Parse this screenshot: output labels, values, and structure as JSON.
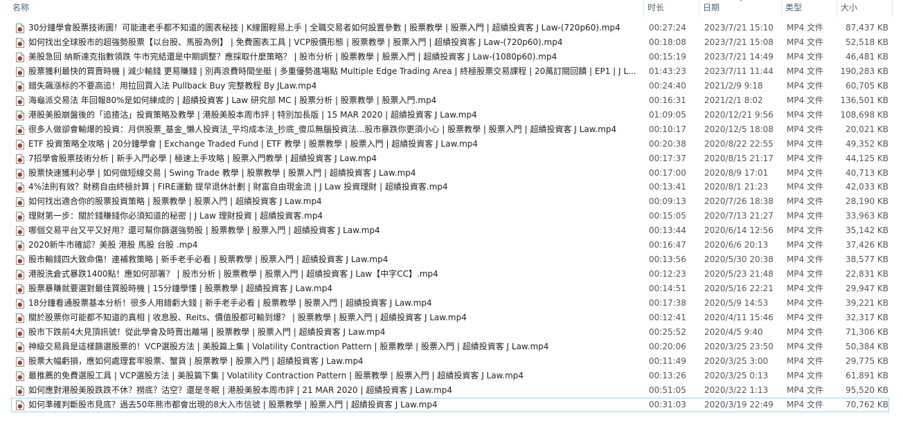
{
  "header": {
    "columns": {
      "name": "名称",
      "duration": "时长",
      "date": "日期",
      "type": "类型",
      "size": "大小"
    },
    "sorted_column": "date"
  },
  "file_icon": "video-file-icon",
  "files": [
    {
      "name": "30分鐘學會股票技術圖！可能連老手都不知道的圖表秘技 | K線圖輕易上手 | 全職交易者如何設置參數 | 股票教學 | 股票入門 | 超績投資客 J Law-(720p60).mp4",
      "duration": "00:27:24",
      "date": "2023/7/21 15:10",
      "type": "MP4 文件",
      "size": "87,437 KB"
    },
    {
      "name": "如何找出全球股市的超強勢股票【以台股、馬股為例】 | 免費圖表工具 | VCP股價形態 | 股票教學 | 股票入門 | 超績投資客 J Law-(720p60).mp4",
      "duration": "00:18:08",
      "date": "2023/7/21 15:08",
      "type": "MP4 文件",
      "size": "52,518 KB"
    },
    {
      "name": "美股急回 納斯達克指數領跌 牛市完結還是中期調整？應採取什麼策略？ | 股市分析 | 股票教學 | 股票入門 | 超績投資客 J Law-(1080p60).mp4",
      "duration": "00:15:19",
      "date": "2023/7/21 14:49",
      "type": "MP4 文件",
      "size": "46,481 KB"
    },
    {
      "name": "股票獲利最快的買賣時機 | 減少輸錢 更易賺錢 | 別再浪費時間坐艇 | 多重優勢進場點 Multiple Edge Trading Area | 終極股票交易課程 | 20萬訂閱回饋 | EP1 | J L...",
      "duration": "01:43:23",
      "date": "2023/7/11 11:44",
      "type": "MP4 文件",
      "size": "190,283 KB"
    },
    {
      "name": "錯失飆漲标的不要高追！用拉回買入法 Pullback Buy 完整教程 By JLaw.mp4",
      "duration": "00:24:40",
      "date": "2021/2/9 9:18",
      "type": "MP4 文件",
      "size": "60,705 KB"
    },
    {
      "name": "海龜派交易法 年回報80%是如何練成的 | 超績投資客 J Law 研究部 MC | 股票分析 | 股票教學 | 股票入門.mp4",
      "duration": "00:16:31",
      "date": "2021/2/1 8:02",
      "type": "MP4 文件",
      "size": "136,501 KB"
    },
    {
      "name": "港股美股崩盤後的「追揸沽」投資策略及教學 | 港股美股本周市評 | 特別加長版 | 15 MAR 2020 | 超績投資客 J Law.mp4",
      "duration": "01:09:05",
      "date": "2020/12/21 9:56",
      "type": "MP4 文件",
      "size": "108,698 KB"
    },
    {
      "name": "很多人做卻會輸爆的投資：月供股票_基金_懶人投資法_平均成本法_抄底_傻瓜無腦投資法...股市暴跌你更須小心 | 股票教學 | 股票入門 | 超績投資客 J Law.mp4",
      "duration": "00:10:17",
      "date": "2020/12/5 18:08",
      "type": "MP4 文件",
      "size": "20,021 KB"
    },
    {
      "name": "ETF 投資策略全攻略 | 20分鐘學會 | Exchange Traded Fund | ETF 教學 | 股票教學 | 股票入門 | 超績投資客 J Law.mp4",
      "duration": "00:20:38",
      "date": "2020/8/22 22:55",
      "type": "MP4 文件",
      "size": "49,352 KB"
    },
    {
      "name": "7招學會股票技術分析 | 新手入門必學 | 極速上手攻略 | 股票入門教學 | 超績投資客 J Law.mp4",
      "duration": "00:17:37",
      "date": "2020/8/15 21:17",
      "type": "MP4 文件",
      "size": "44,125 KB"
    },
    {
      "name": "股票快速獲利必學 | 如何做短線交易 | Swing Trade 教學 | 股票教學 | 股票入門 | 超績投資客 J Law.mp4",
      "duration": "00:17:00",
      "date": "2020/8/9 17:01",
      "type": "MP4 文件",
      "size": "40,713 KB"
    },
    {
      "name": "4%法則有效？財務自由終極計算 | FIRE運動 提早退休計劃 | 財富自由現金流 | J Law 投資理財 | 超績投資客.mp4",
      "duration": "00:13:41",
      "date": "2020/8/1 21:23",
      "type": "MP4 文件",
      "size": "42,033 KB"
    },
    {
      "name": "如何找出適合你的股票投資策略 | 股票教學 | 股票入門 | 超績投資客 J Law.mp4",
      "duration": "00:09:13",
      "date": "2020/7/26 18:38",
      "type": "MP4 文件",
      "size": "28,190 KB"
    },
    {
      "name": "理財第一步：關於錢賺錢你必須知道的秘密 | J Law 理財投資 | 超績投資客.mp4",
      "duration": "00:15:05",
      "date": "2020/7/13 21:27",
      "type": "MP4 文件",
      "size": "33,963 KB"
    },
    {
      "name": "哪個交易平台又平又好用？還可幫你篩選強勢股 | 股票教學 | 股票入門 | 超績投資客 J Law.mp4",
      "duration": "00:13:44",
      "date": "2020/6/14 12:56",
      "type": "MP4 文件",
      "size": "35,142 KB"
    },
    {
      "name": "2020新牛市確認？美股 港股 馬股 台股 .mp4",
      "duration": "00:16:47",
      "date": "2020/6/6 20:13",
      "type": "MP4 文件",
      "size": "37,426 KB"
    },
    {
      "name": "股市輸錢四大致命傷！連補救策略 | 新手老手必看 | 股票教學 | 股票入門 | 超績投資客 J Law.mp4",
      "duration": "00:13:56",
      "date": "2020/5/30 20:38",
      "type": "MP4 文件",
      "size": "38,577 KB"
    },
    {
      "name": "港股洗倉式暴跌1400點！應如何部署？ | 股市分析 | 股票教學 | 股票入門 | 超績投資客 J Law【中字CC】.mp4",
      "duration": "00:12:23",
      "date": "2020/5/23 21:48",
      "type": "MP4 文件",
      "size": "22,831 KB"
    },
    {
      "name": "股票暴賺就要選對最佳買股時機 | 15分鐘學懂 | 股票教學 | 超績投資客 J Law.mp4",
      "duration": "00:14:51",
      "date": "2020/5/16 22:21",
      "type": "MP4 文件",
      "size": "29,947 KB"
    },
    {
      "name": "18分鐘看通股票基本分析！很多人用錯虧大錢 | 新手老手必看 | 股票教學 | 股票入門 | 超績投資客 J Law.mp4",
      "duration": "00:17:38",
      "date": "2020/5/9 14:53",
      "type": "MP4 文件",
      "size": "39,221 KB"
    },
    {
      "name": "關於股票你可能都不知道的真相 | 收息股、Reits、價值股都可輸到爆？ | 股票教學 | 股票入門 | 超績投資客 J Law.mp4",
      "duration": "00:12:41",
      "date": "2020/4/11 15:46",
      "type": "MP4 文件",
      "size": "32,317 KB"
    },
    {
      "name": "股市下跌前4大見頂訊號！從此學會及時賣出離場 | 股票教學 | 股票入門 | 超績投資客 J Law.mp4",
      "duration": "00:25:52",
      "date": "2020/4/5 9:40",
      "type": "MP4 文件",
      "size": "71,306 KB"
    },
    {
      "name": "神級交易員是這樣篩選股票的！VCP選股方法 | 美股篇上集 | Volatility Contraction Pattern | 股票教學 | 股票入門 | 超績投資客 J Law.mp4",
      "duration": "00:20:06",
      "date": "2020/3/25 23:50",
      "type": "MP4 文件",
      "size": "50,384 KB"
    },
    {
      "name": "股票大幅虧損，應如何處理套牢股票、蟹貨 | 股票教學 | 股票入門 | 超績投資客 J Law.mp4",
      "duration": "00:11:49",
      "date": "2020/3/25 3:00",
      "type": "MP4 文件",
      "size": "29,775 KB"
    },
    {
      "name": "最推薦的免費選股工具 | VCP選股方法 | 美股篇下集 | Volatility Contraction Pattern | 股票教學 | 股票入門 | 超績投資客 J Law.mp4",
      "duration": "00:13:26",
      "date": "2020/3/25 0:13",
      "type": "MP4 文件",
      "size": "61,891 KB"
    },
    {
      "name": "如何應對港股美股跌跌不休？撈底？沽空？還是冬眠 | 港股美股本周市評 | 21 MAR 2020 | 超績投資客 J Law.mp4",
      "duration": "00:51:05",
      "date": "2020/3/22 1:13",
      "type": "MP4 文件",
      "size": "95,520 KB"
    },
    {
      "name": "如何準確判斷股市見底？過去50年熊市都會出現的8大入市信號 | 股票教學 | 股票入門 | 超績投資客 J Law.mp4",
      "duration": "00:31:03",
      "date": "2020/3/19 22:49",
      "type": "MP4 文件",
      "size": "70,762 KB",
      "focused": true
    }
  ]
}
